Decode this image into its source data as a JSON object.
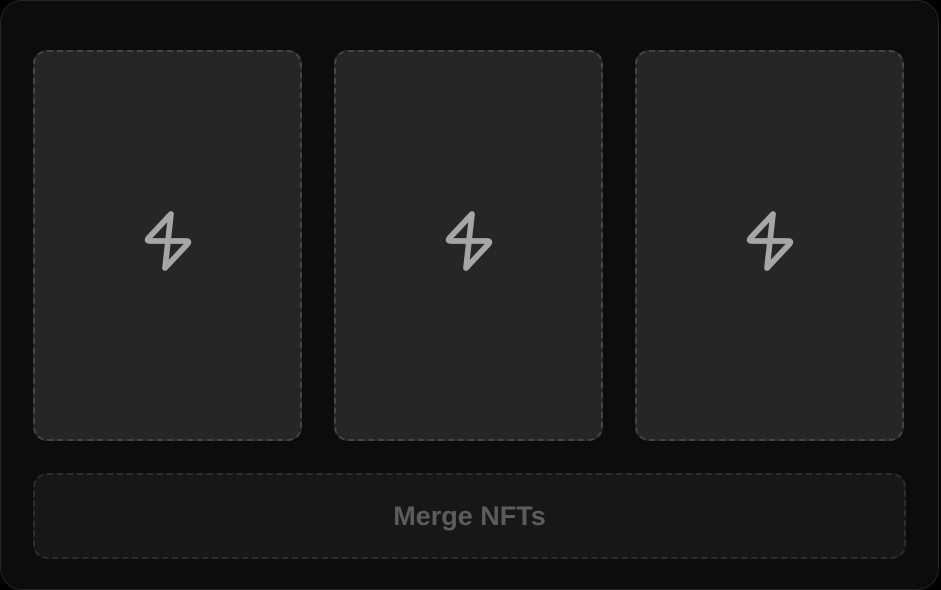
{
  "slots": [
    {
      "icon": "lightning-bolt-icon"
    },
    {
      "icon": "lightning-bolt-icon"
    },
    {
      "icon": "lightning-bolt-icon"
    }
  ],
  "merge_button": {
    "label": "Merge NFTs",
    "enabled": false
  },
  "colors": {
    "background": "#0c0c0c",
    "slot_fill": "#262626",
    "slot_border": "#454545",
    "icon": "#a6a6a6",
    "button_fill": "#171717",
    "button_text": "#5c5c5c"
  }
}
